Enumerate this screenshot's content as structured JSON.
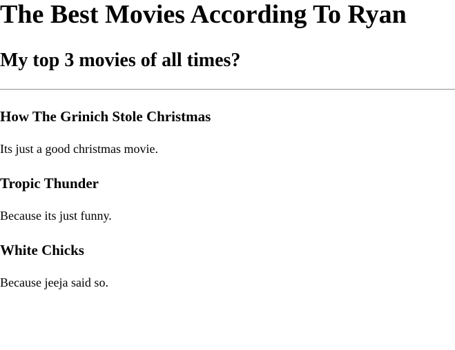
{
  "page": {
    "title": "The Best Movies According To Ryan",
    "subtitle": "My top 3 movies of all times?"
  },
  "movies": [
    {
      "title": "How The Grinich Stole Christmas",
      "reason": "Its just a good christmas movie."
    },
    {
      "title": "Tropic Thunder",
      "reason": "Because its just funny."
    },
    {
      "title": "White Chicks",
      "reason": "Because jeeja said so."
    }
  ]
}
